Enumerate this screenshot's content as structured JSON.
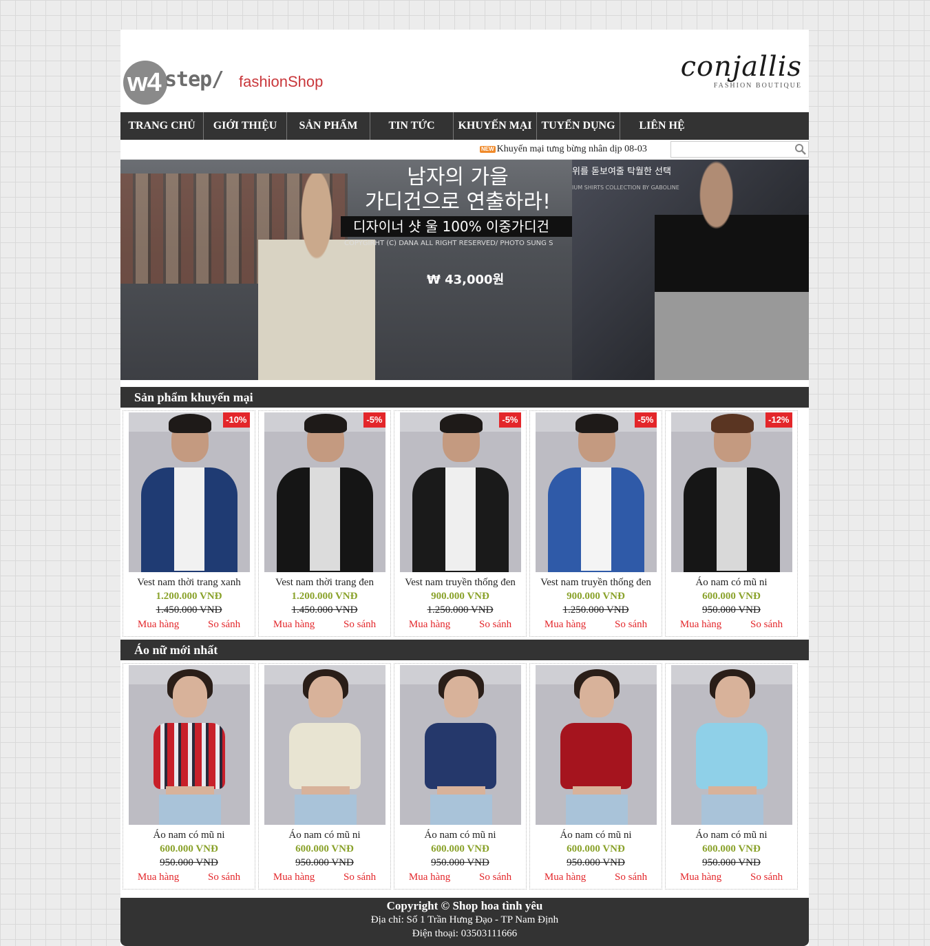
{
  "header": {
    "logo_w4": "w4",
    "logo_step": "step/",
    "logo_shop": "fashionShop",
    "brand_name": "conjallis",
    "brand_sub": "FASHION BOUTIQUE"
  },
  "nav": [
    "TRANG CHỦ",
    "GIỚI THIỆU",
    "SẢN PHẨM",
    "TIN TỨC",
    "KHUYẾN MẠI",
    "TUYỂN DỤNG",
    "LIÊN HỆ"
  ],
  "ticker": {
    "badge": "NEW",
    "text": "Khuyến mại tưng bừng nhân dịp 08-03",
    "search_placeholder": ""
  },
  "banner": {
    "kr_line1": "남자의 가을",
    "kr_line2": "가디건으로 연출하라!",
    "kr_bar": "디자이너 샷 울 100% 이중가디건",
    "copyright": "COPYGIRHT (C) DANA ALL RIGHT RESERVED/ PHOTO SUNG S",
    "price": "₩ 43,000원",
    "right_kr": "위를 돋보여줄 탁월한 선택",
    "right_sub": "IUM SHIRTS COLLECTION BY GABOLINE"
  },
  "sections": [
    {
      "title": "Sản phẩm khuyến mại",
      "items": [
        {
          "name": "Vest nam thời trang xanh",
          "price": "1.200.000 VNĐ",
          "old": "1.450.000 VNĐ",
          "badge": "-10%",
          "buy": "Mua hàng",
          "compare": "So sánh"
        },
        {
          "name": "Vest nam thời trang đen",
          "price": "1.200.000 VNĐ",
          "old": "1.450.000 VNĐ",
          "badge": "-5%",
          "buy": "Mua hàng",
          "compare": "So sánh"
        },
        {
          "name": "Vest nam truyền thống đen",
          "price": "900.000 VNĐ",
          "old": "1.250.000 VNĐ",
          "badge": "-5%",
          "buy": "Mua hàng",
          "compare": "So sánh"
        },
        {
          "name": "Vest nam truyền thống đen",
          "price": "900.000 VNĐ",
          "old": "1.250.000 VNĐ",
          "badge": "-5%",
          "buy": "Mua hàng",
          "compare": "So sánh"
        },
        {
          "name": "Áo nam có mũ ni",
          "price": "600.000 VNĐ",
          "old": "950.000 VNĐ",
          "badge": "-12%",
          "buy": "Mua hàng",
          "compare": "So sánh"
        }
      ]
    },
    {
      "title": "Áo nữ mới nhất",
      "items": [
        {
          "name": "Áo nam có mũ ni",
          "price": "600.000 VNĐ",
          "old": "950.000 VNĐ",
          "buy": "Mua hàng",
          "compare": "So sánh"
        },
        {
          "name": "Áo nam có mũ ni",
          "price": "600.000 VNĐ",
          "old": "950.000 VNĐ",
          "buy": "Mua hàng",
          "compare": "So sánh"
        },
        {
          "name": "Áo nam có mũ ni",
          "price": "600.000 VNĐ",
          "old": "950.000 VNĐ",
          "buy": "Mua hàng",
          "compare": "So sánh"
        },
        {
          "name": "Áo nam có mũ ni",
          "price": "600.000 VNĐ",
          "old": "950.000 VNĐ",
          "buy": "Mua hàng",
          "compare": "So sánh"
        },
        {
          "name": "Áo nam có mũ ni",
          "price": "600.000 VNĐ",
          "old": "950.000 VNĐ",
          "buy": "Mua hàng",
          "compare": "So sánh"
        }
      ]
    }
  ],
  "footer": {
    "copyright": "Copyright © Shop hoa tình yêu",
    "address": "Địa chỉ: Số 1 Trần Hưng Đạo - TP Nam Định",
    "phone": "Điện thoại: 03503111666"
  },
  "colors": {
    "nav_bg": "#333333",
    "accent_red": "#e3262a",
    "price_green": "#8aa22b"
  }
}
